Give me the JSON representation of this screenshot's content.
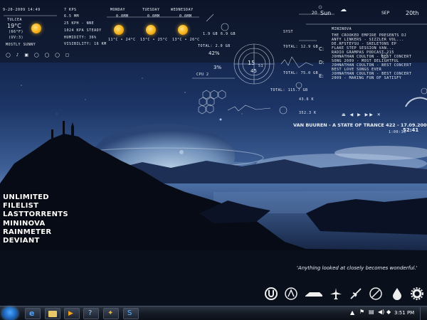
{
  "weather": {
    "date": "9-20-2009 14:49",
    "location": "TULCEA",
    "temp_c": "19°C",
    "temp_f": "(66°F)",
    "uv": "(UV:3)",
    "condition": "MOSTLY SUNNY",
    "humidity": "HUMIDITY: 36%",
    "visibility": "VISIBILITY: 16 KM",
    "wind": "25 KPH - NNE",
    "pressure": "1024 KPA STEADY",
    "dewpoint": "6.5 MM",
    "feels": "7 KPS",
    "forecast": [
      {
        "day": "MONDAY",
        "percip": "0.0MM",
        "range": "11°C • 24°C"
      },
      {
        "day": "TUESDAY",
        "percip": "0.0MM",
        "range": "13°C • 25°C"
      },
      {
        "day": "WEDNESDAY",
        "percip": "0.0MM",
        "range": "13°C • 26°C"
      }
    ]
  },
  "system": {
    "ram_total": "TOTAL: 2.0 GB",
    "ram_pct": "42%",
    "cpu_pct": "3%",
    "cpu2": "CPU 2",
    "disk_c": "TOTAL: 12.9 GB",
    "disk_c_free": "6.9 GB",
    "disk_d": "TOTAL: 75.0 GB",
    "disk_e": "TOTAL: 115.7 GB",
    "net_in": "43.6 K",
    "net_out": "352.3 K",
    "net_total": "43.6 K",
    "drive_labels": [
      "C:",
      "D:",
      "E:"
    ]
  },
  "clock": {
    "hour": "15",
    "sec": "51",
    "min": "45",
    "day_num": "20",
    "day_name": "Sun",
    "month": "SEP",
    "date": "20th"
  },
  "news": {
    "source": "MININOVA",
    "items": [
      "THE CROOKED EMPIRE PRESENTS DJ",
      "ANTY LINKERS - SIZZLER VOL...",
      "DE.RFSTEYSU - SKELETONS EP",
      "FLAKE STEP SESSION VAN...",
      "RADIO GRAMPAS PODCAST 215",
      "JOHNATHAN COULTON - BEST CONCERT",
      "SONG 2009 - MOST DELIGHTFUL",
      "JOHNATHAN COULTON - BEST CONCERT",
      "BEST LOVE SONGS EVER",
      "JOHNATHAN COULTON - BEST CONCERT",
      "2009 - MAKING FUN OF SATISFY"
    ]
  },
  "player": {
    "track": "VAN BUUREN - A STATE OF TRANCE 422 - 17.09.2009",
    "elapsed": "1:00:16",
    "remaining": "52:41"
  },
  "launcher": [
    "UNLIMITED",
    "FILELIST",
    "LASTTORRENTS",
    "MININOVA",
    "RAINMETER",
    "DEVIANT"
  ],
  "quote": "'Anything looked at closely becomes wonderful.'",
  "dock": [
    "utorrent-icon",
    "counter-strike-icon",
    "need-for-speed-icon",
    "plane-icon",
    "fighter-jet-icon",
    "photoshop-icon",
    "rainmeter-icon",
    "settings-icon"
  ],
  "taskbar": {
    "time": "3:51 PM"
  }
}
